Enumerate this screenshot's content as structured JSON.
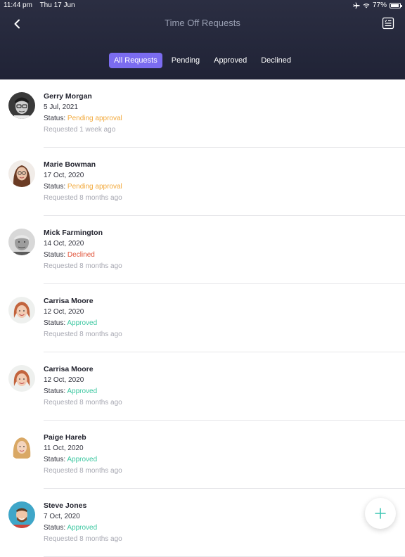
{
  "status_bar": {
    "time": "11:44 pm",
    "date": "Thu 17 Jun",
    "battery": "77%"
  },
  "header": {
    "title": "Time Off Requests"
  },
  "tabs": [
    {
      "label": "All Requests",
      "active": true
    },
    {
      "label": "Pending",
      "active": false
    },
    {
      "label": "Approved",
      "active": false
    },
    {
      "label": "Declined",
      "active": false
    }
  ],
  "colors": {
    "header_bg": "#242739",
    "tab_active": "#7b6cf0",
    "pending": "#f2a93b",
    "declined": "#e0533a",
    "approved": "#3bc7a0",
    "fab_plus": "#3ec6b4"
  },
  "status_prefix": "Status: ",
  "requests": [
    {
      "name": "Gerry Morgan",
      "date": "5 Jul, 2021",
      "status": "Pending approval",
      "status_type": "pending",
      "requested": "Requested 1 week ago",
      "avatar": "bw-man-glasses"
    },
    {
      "name": "Marie Bowman",
      "date": "17 Oct, 2020",
      "status": "Pending approval",
      "status_type": "pending",
      "requested": "Requested 8 months ago",
      "avatar": "woman-brown-hair"
    },
    {
      "name": "Mick Farmington",
      "date": "14 Oct, 2020",
      "status": "Declined",
      "status_type": "declined",
      "requested": "Requested 8 months ago",
      "avatar": "bw-man-grey"
    },
    {
      "name": "Carrisa Moore",
      "date": "12 Oct, 2020",
      "status": "Approved",
      "status_type": "approved",
      "requested": "Requested 8 months ago",
      "avatar": "woman-red-hair"
    },
    {
      "name": "Carrisa Moore",
      "date": "12 Oct, 2020",
      "status": "Approved",
      "status_type": "approved",
      "requested": "Requested 8 months ago",
      "avatar": "woman-red-hair"
    },
    {
      "name": "Paige Hareb",
      "date": "11 Oct, 2020",
      "status": "Approved",
      "status_type": "approved",
      "requested": "Requested 8 months ago",
      "avatar": "woman-blonde"
    },
    {
      "name": "Steve Jones",
      "date": "7 Oct, 2020",
      "status": "Approved",
      "status_type": "approved",
      "requested": "Requested 8 months ago",
      "avatar": "man-blue-bg"
    }
  ]
}
